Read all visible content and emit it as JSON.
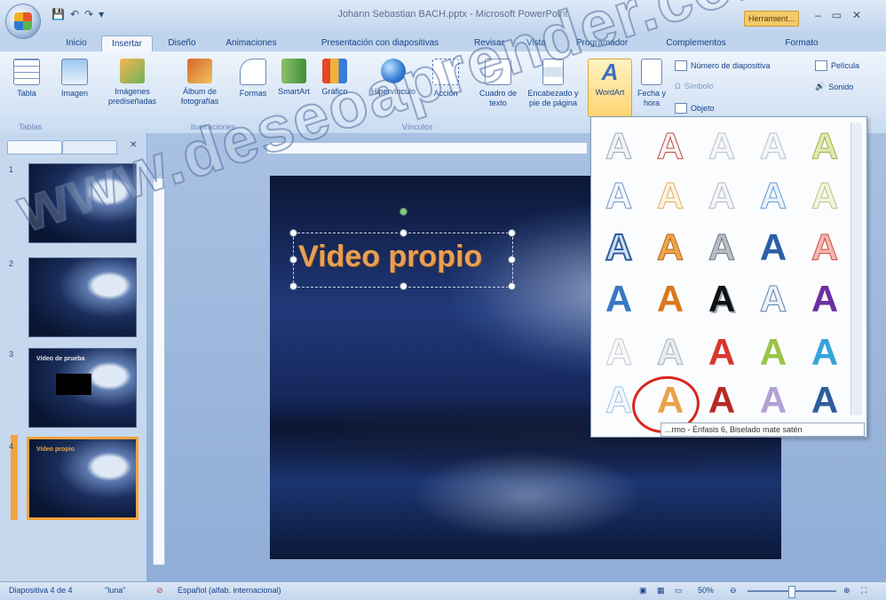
{
  "window": {
    "title": "Johann Sebastian BACH.pptx - Microsoft PowerPoint",
    "tools_badge": "Herramient...",
    "controls": [
      "–",
      "▭",
      "✕"
    ]
  },
  "qat": [
    "💾",
    "↶",
    "↷",
    "▾"
  ],
  "tabs": [
    "Inicio",
    "Insertar",
    "Diseño",
    "Animaciones",
    "Presentación con diapositivas",
    "Revisar",
    "Vista",
    "Programador",
    "Complementos",
    "Formato"
  ],
  "ribbon": {
    "groups": {
      "tablas": "Tablas",
      "ilustraciones": "Ilustraciones",
      "vinculos": "Vínculos"
    },
    "buttons": {
      "tabla": "Tabla",
      "imagen": "Imagen",
      "imagenes_predisenadas": "Imágenes prediseñadas",
      "album": "Álbum de fotografías",
      "formas": "Formas",
      "smartart": "SmartArt",
      "grafico": "Gráfico",
      "hipervinculo": "Hipervínculo",
      "accion": "Acción",
      "cuadro_texto": "Cuadro de texto",
      "encabezado": "Encabezado y pie de página",
      "wordart": "WordArt",
      "fecha": "Fecha y hora",
      "numero_diapositiva": "Número de diapositiva",
      "simbolo": "Símbolo",
      "objeto": "Objeto",
      "pelicula": "Película",
      "sonido": "Sonido"
    }
  },
  "slides": {
    "numbers": [
      "1",
      "2",
      "3",
      "4"
    ],
    "thumb3_text": "Vídeo de prueba",
    "thumb4_text": "Vídeo propio"
  },
  "slide": {
    "title": "Video propio"
  },
  "gallery": {
    "letter": "A",
    "tooltip": "...rmo - Énfasis 6, Biselado mate satén"
  },
  "watermark": "www.deseoaprender.com",
  "status": {
    "slide_info": "Diapositiva 4 de 4",
    "theme": "\"luna\"",
    "language": "Español (alfab. internacional)",
    "zoom": "50%"
  }
}
